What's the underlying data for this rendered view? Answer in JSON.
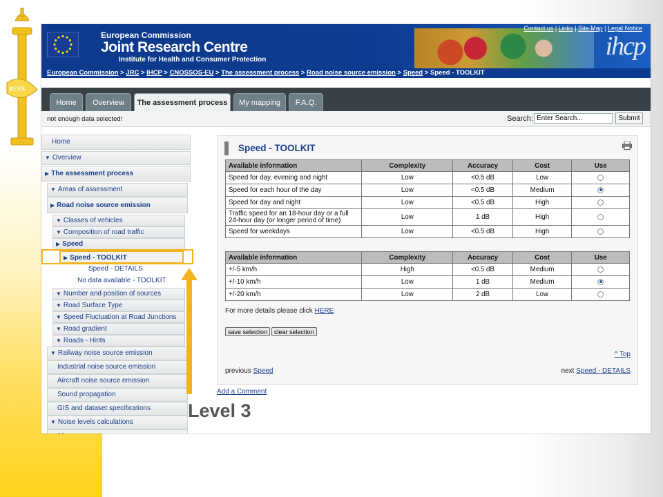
{
  "banner": {
    "line1": "European Commission",
    "line2": "Joint Research Centre",
    "line3": "Institute for Health and Consumer Protection",
    "logo": "ihcp",
    "toplinks": [
      "Contact us",
      "Links",
      "Site Map",
      "Legal Notice"
    ]
  },
  "breadcrumb": [
    {
      "label": "European Commission",
      "link": true
    },
    {
      "label": "JRC",
      "link": true
    },
    {
      "label": "IHCP",
      "link": true
    },
    {
      "label": "CNOSSOS-EU",
      "link": true
    },
    {
      "label": "The assessment process",
      "link": true
    },
    {
      "label": "Road noise source emission",
      "link": true
    },
    {
      "label": "Speed",
      "link": true
    },
    {
      "label": "Speed - TOOLKIT",
      "link": false
    }
  ],
  "tabs": [
    "Home",
    "Overview",
    "The assessment process",
    "My mapping",
    "F.A.Q."
  ],
  "status": {
    "message": "not enough data selected!",
    "search_label": "Search:",
    "search_value": "Enter Search...",
    "submit_label": "Submit"
  },
  "sidebar": [
    {
      "label": "Home",
      "arrow": "",
      "bold": false
    },
    {
      "label": "Overview",
      "arrow": "down",
      "bold": false
    },
    {
      "label": "The assessment process",
      "arrow": "right",
      "bold": true
    },
    {
      "label": "Areas of assessment",
      "arrow": "down",
      "bold": false
    },
    {
      "label": "Road noise source emission",
      "arrow": "right",
      "bold": true
    },
    {
      "label": "Classes of vehicles",
      "arrow": "down",
      "bold": false
    },
    {
      "label": "Composition of road traffic",
      "arrow": "down",
      "bold": false
    },
    {
      "label": "Speed",
      "arrow": "right",
      "bold": true
    },
    {
      "label": "Speed - TOOLKIT",
      "arrow": "right",
      "bold": true
    },
    {
      "label": "Speed - DETAILS",
      "arrow": "",
      "bold": false
    },
    {
      "label": "No data available - TOOLKIT",
      "arrow": "",
      "bold": false
    },
    {
      "label": "Number and position of sources",
      "arrow": "down",
      "bold": false
    },
    {
      "label": "Road Surface Type",
      "arrow": "down",
      "bold": false
    },
    {
      "label": "Speed Fluctuation at Road Junctions",
      "arrow": "down",
      "bold": false
    },
    {
      "label": "Road gradient",
      "arrow": "down",
      "bold": false
    },
    {
      "label": "Roads - Hints",
      "arrow": "down",
      "bold": false
    },
    {
      "label": "Railway noise source emission",
      "arrow": "down",
      "bold": false
    },
    {
      "label": "Industrial noise source emission",
      "arrow": "",
      "bold": false
    },
    {
      "label": "Aircraft noise source emission",
      "arrow": "",
      "bold": false
    },
    {
      "label": "Sound propagation",
      "arrow": "",
      "bold": false
    },
    {
      "label": "GIS and dataset specifications",
      "arrow": "",
      "bold": false
    },
    {
      "label": "Noise levels calculations",
      "arrow": "down",
      "bold": false
    },
    {
      "label": "Measurements",
      "arrow": "down",
      "bold": false
    }
  ],
  "content": {
    "title": "Speed",
    "title_sep": " - ",
    "title_sub": "TOOLKIT",
    "headers": [
      "Available information",
      "Complexity",
      "Accuracy",
      "Cost",
      "Use"
    ],
    "table1": [
      {
        "info": "Speed for day, evening and night",
        "complexity": "Low",
        "accuracy": "<0.5 dB",
        "cost": "Low",
        "selected": false
      },
      {
        "info": "Speed for each hour of the day",
        "complexity": "Low",
        "accuracy": "<0.5 dB",
        "cost": "Medium",
        "selected": true
      },
      {
        "info": "Speed for day and night",
        "complexity": "Low",
        "accuracy": "<0.5 dB",
        "cost": "High",
        "selected": false
      },
      {
        "info": "Traffic speed for an 18-hour day or a full 24-hour day (or longer period of time)",
        "complexity": "Low",
        "accuracy": "1 dB",
        "cost": "High",
        "selected": false
      },
      {
        "info": "Speed for weekdays",
        "complexity": "Low",
        "accuracy": "<0.5 dB",
        "cost": "High",
        "selected": false
      }
    ],
    "table2": [
      {
        "info": "+/-5 km/h",
        "complexity": "High",
        "accuracy": "<0.5 dB",
        "cost": "Medium",
        "selected": false
      },
      {
        "info": "+/-10 km/h",
        "complexity": "Low",
        "accuracy": "1 dB",
        "cost": "Medium",
        "selected": true
      },
      {
        "info": "+/-20 km/h",
        "complexity": "Low",
        "accuracy": "2 dB",
        "cost": "Low",
        "selected": false
      }
    ],
    "more_prefix": "For more details please click ",
    "more_link": "HERE",
    "save_label": "save selection",
    "clear_label": "clear selection",
    "top_link": "^ Top",
    "prev_prefix": "previous ",
    "prev_link": "Speed",
    "next_prefix": "next ",
    "next_link": "Speed - DETAILS"
  },
  "add_comment": "Add a Comment",
  "level_label": "Level 3",
  "colors": {
    "accent_yellow": "#f3b31c",
    "banner_blue": "#0d3b8f",
    "link_blue": "#1b3f8a"
  }
}
